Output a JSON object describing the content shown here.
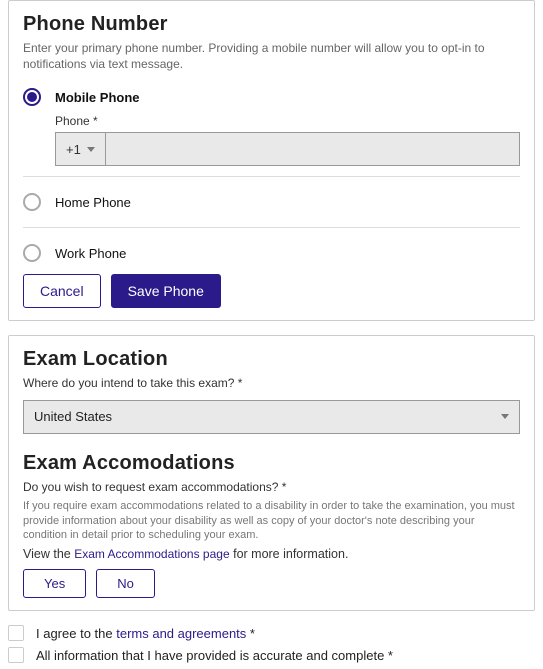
{
  "phone": {
    "title": "Phone Number",
    "help": "Enter your primary phone number. Providing a mobile number will allow you to opt-in to notifications via text message.",
    "options": {
      "mobile": "Mobile Phone",
      "home": "Home Phone",
      "work": "Work Phone"
    },
    "sub_label": "Phone *",
    "country_code": "+1",
    "phone_value": "",
    "cancel": "Cancel",
    "save": "Save Phone"
  },
  "location": {
    "title": "Exam Location",
    "question": "Where do you intend to take this exam? *",
    "selected": "United States"
  },
  "accom": {
    "title": "Exam Accomodations",
    "question": "Do you wish to request exam accommodations? *",
    "hint": "If you require exam accommodations related to a disability in order to take the examination, you must provide information about your disability as well as copy of your doctor's note describing your condition in detail prior to scheduling your exam.",
    "info_prefix": "View the ",
    "info_link": "Exam Accommodations page",
    "info_suffix": " for more information.",
    "yes": "Yes",
    "no": "No"
  },
  "agree": {
    "terms_prefix": "I agree to the ",
    "terms_link": "terms and agreements",
    "terms_suffix": " *",
    "accurate": "All information that I have provided is accurate and complete *"
  }
}
